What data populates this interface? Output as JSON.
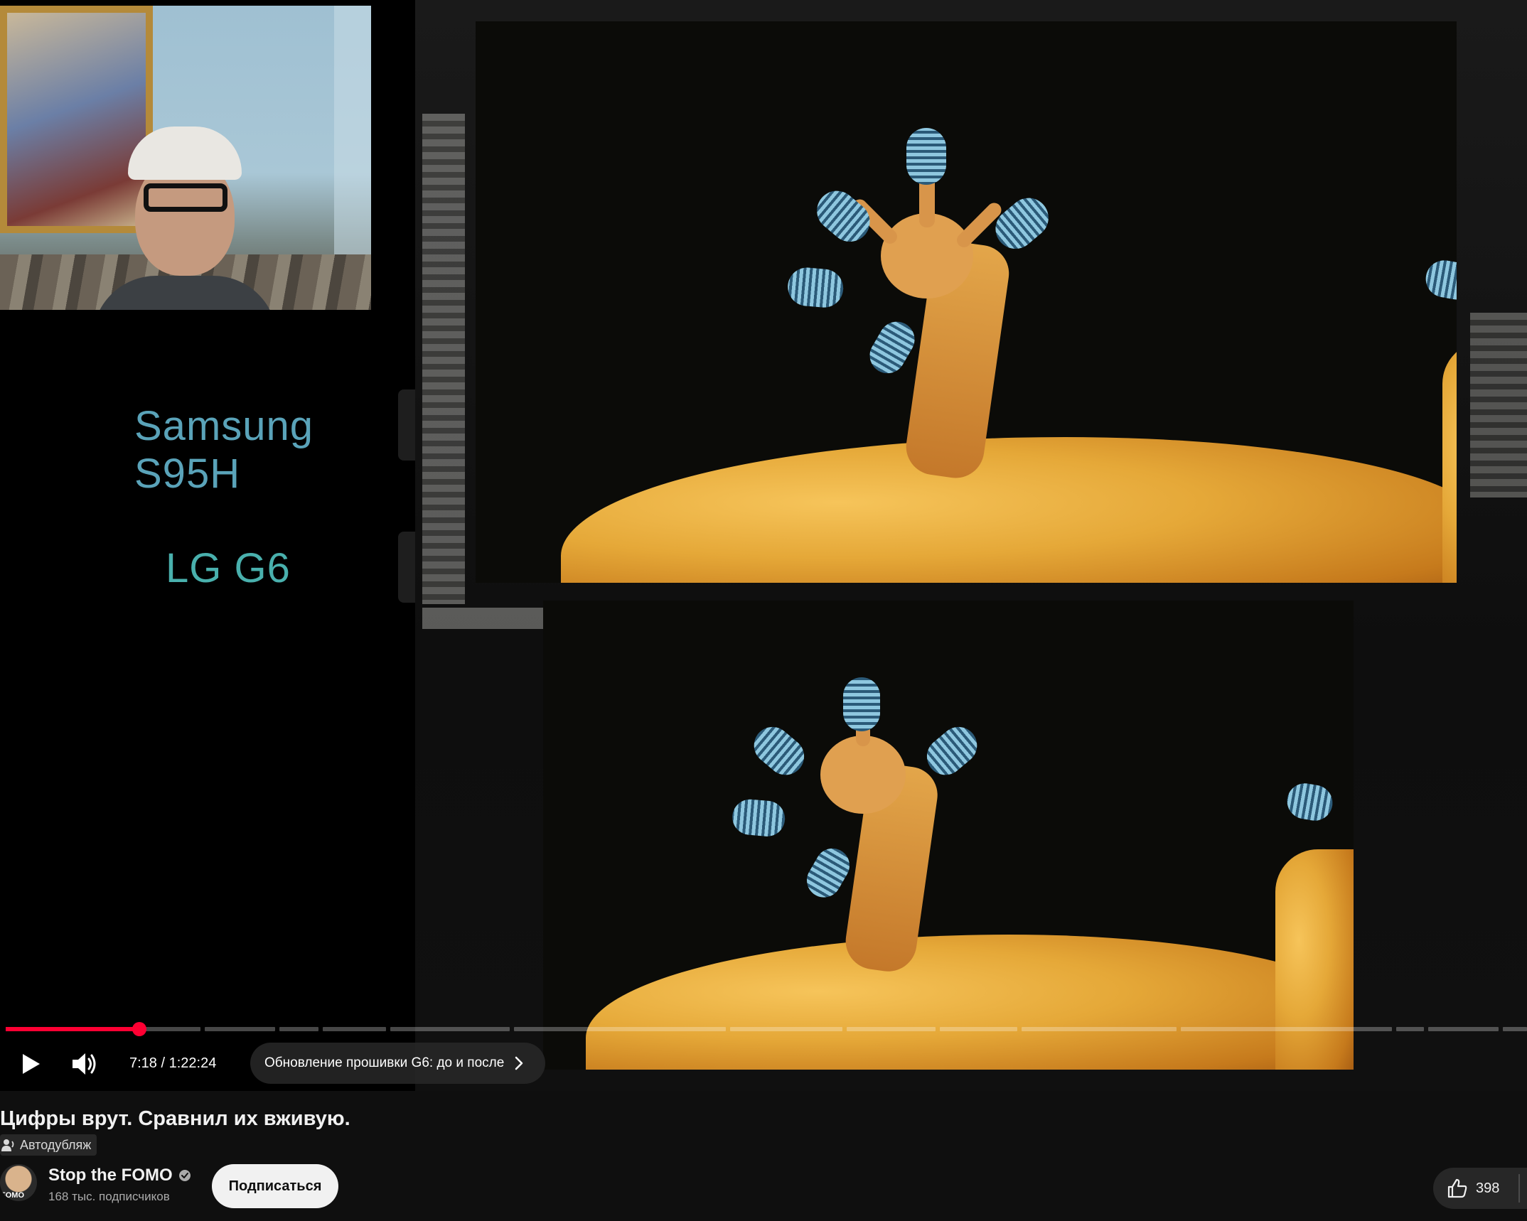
{
  "video": {
    "labels": {
      "top": "Samsung S95H",
      "bottom": "LG G6"
    },
    "time_current": "7:18",
    "time_separator": "/",
    "time_total": "1:22:24",
    "chapter_title": "Обновление прошивки G6: до и после",
    "progress_fraction": 0.088,
    "accent_color": "#ff0033",
    "icons": {
      "play": "play-icon",
      "volume": "volume-icon",
      "chapter_arrow": "chevron-right-icon"
    }
  },
  "meta": {
    "title": "Цифры врут. Сравнил их вживую.",
    "dub_label": "Автодубляж",
    "channel_name": "Stop the FOMO",
    "subscribers": "168 тыс. подписчиков",
    "subscribe_label": "Подписаться",
    "avatar_text": "FOMO",
    "like_count": "398",
    "icons": {
      "verified": "verified-check-icon",
      "like": "thumbs-up-icon",
      "dub": "audio-dub-icon"
    }
  }
}
